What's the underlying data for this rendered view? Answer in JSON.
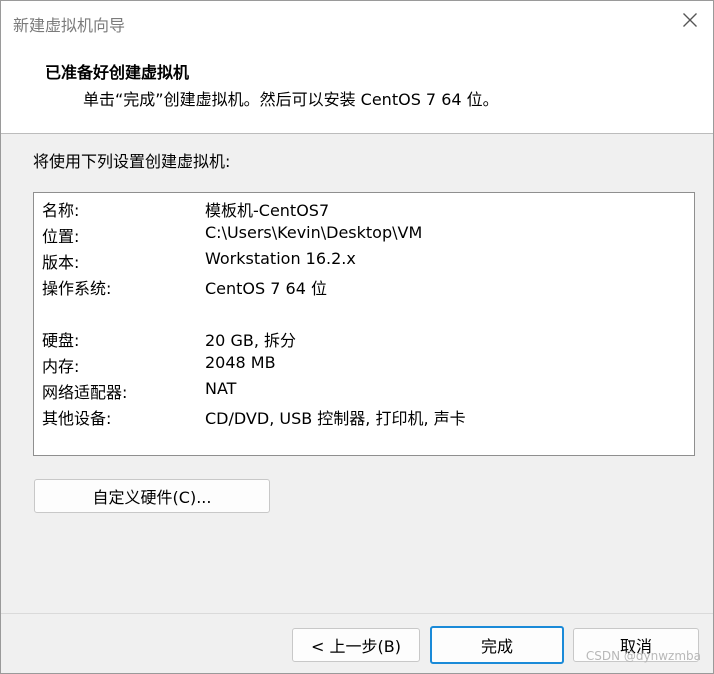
{
  "window": {
    "title": "新建虚拟机向导"
  },
  "header": {
    "title": "已准备好创建虚拟机",
    "subtitle": "单击“完成”创建虚拟机。然后可以安装 CentOS 7 64 位。"
  },
  "intro": "将使用下列设置创建虚拟机:",
  "settings": [
    {
      "key": "名称:",
      "value": "模板机-CentOS7"
    },
    {
      "key": "位置:",
      "value": "C:\\Users\\Kevin\\Desktop\\VM"
    },
    {
      "key": "版本:",
      "value": "Workstation 16.2.x"
    },
    {
      "key": "操作系统:",
      "value": "CentOS 7 64 位"
    },
    {
      "key": "硬盘:",
      "value": "20 GB, 拆分"
    },
    {
      "key": "内存:",
      "value": "2048 MB"
    },
    {
      "key": "网络适配器:",
      "value": "NAT"
    },
    {
      "key": "其他设备:",
      "value": "CD/DVD, USB 控制器, 打印机, 声卡"
    }
  ],
  "buttons": {
    "customize": "自定义硬件(C)...",
    "back": "< 上一步(B)",
    "finish": "完成",
    "cancel": "取消"
  },
  "watermark": "CSDN @dynwzmba",
  "colors": {
    "focus_border": "#1a8ad8"
  }
}
